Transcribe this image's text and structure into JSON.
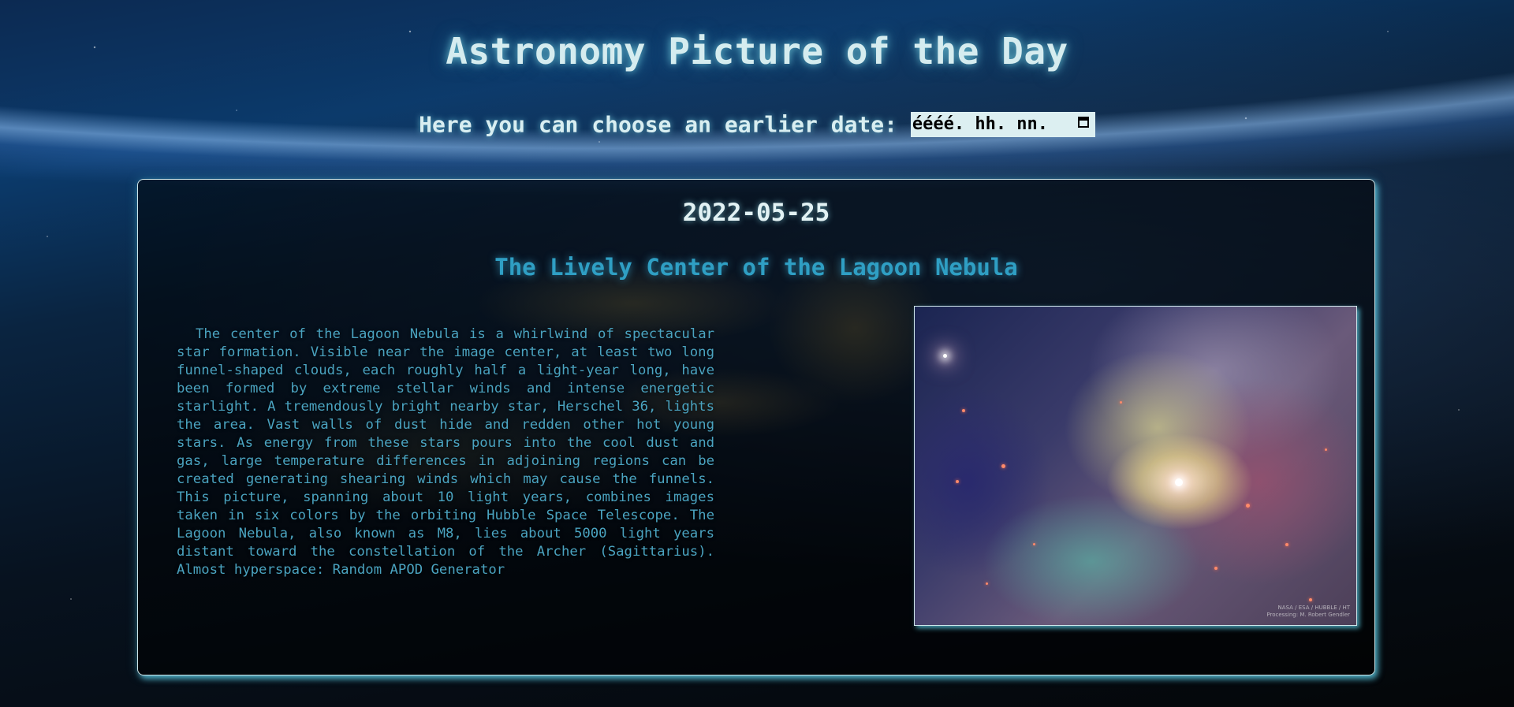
{
  "page": {
    "title": "Astronomy Picture of the Day"
  },
  "date_picker": {
    "label": "Here you can choose an earlier date:",
    "placeholder": "éééé. hh. nn.",
    "icon": "calendar-icon"
  },
  "apod": {
    "date": "2022-05-25",
    "title": "The Lively Center of the Lagoon Nebula",
    "explanation": "The center of the Lagoon Nebula is a whirlwind of spectacular star formation. Visible near the image center, at least two long funnel-shaped clouds, each roughly half a light-year long, have been formed by extreme stellar winds and intense energetic starlight. A tremendously bright nearby star, Herschel 36, lights the area. Vast walls of dust hide and redden other hot young stars. As energy from these stars pours into the cool dust and gas, large temperature differences in adjoining regions can be created generating shearing winds which may cause the funnels. This picture, spanning about 10 light years, combines images taken in six colors by the orbiting Hubble Space Telescope. The Lagoon Nebula, also known as M8, lies about 5000 light years distant toward the constellation of the Archer (Sagittarius). Almost hyperspace: Random APOD Generator",
    "image_credit_line1": "NASA / ESA / HUBBLE / HT",
    "image_credit_line2": "Processing: M. Robert Gendler"
  },
  "colors": {
    "title_glow": "#d5ecef",
    "apod_title": "#2f9fc4",
    "body_text": "#4aa3c0",
    "card_border": "#cfe6ea"
  }
}
